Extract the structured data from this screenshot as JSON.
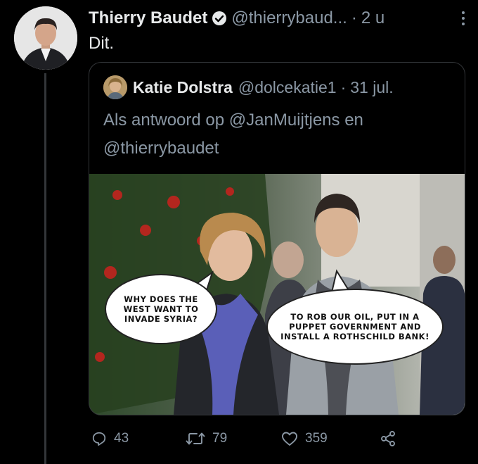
{
  "tweet": {
    "author_name": "Thierry Baudet",
    "author_handle": "@thierrybaud...",
    "separator": "·",
    "time": "2 u",
    "text": "Dit."
  },
  "quote": {
    "author_name": "Katie Dolstra",
    "author_handle": "@dolcekatie1",
    "separator": "·",
    "time": "31 jul.",
    "reply_text": "Als antwoord op @JanMuijtjens en @thierrybaudet",
    "image": {
      "bubble_left": "WHY DOES THE\nWEST WANT TO\nINVADE SYRIA?",
      "bubble_right": "TO ROB OUR OIL, PUT IN A\nPUPPET GOVERNMENT AND\nINSTALL A ROTHSCHILD BANK!"
    }
  },
  "actions": {
    "replies": "43",
    "retweets": "79",
    "likes": "359"
  },
  "colors": {
    "background": "#000000",
    "text": "#e7e9ea",
    "muted": "#8b98a5",
    "border": "#333639"
  }
}
